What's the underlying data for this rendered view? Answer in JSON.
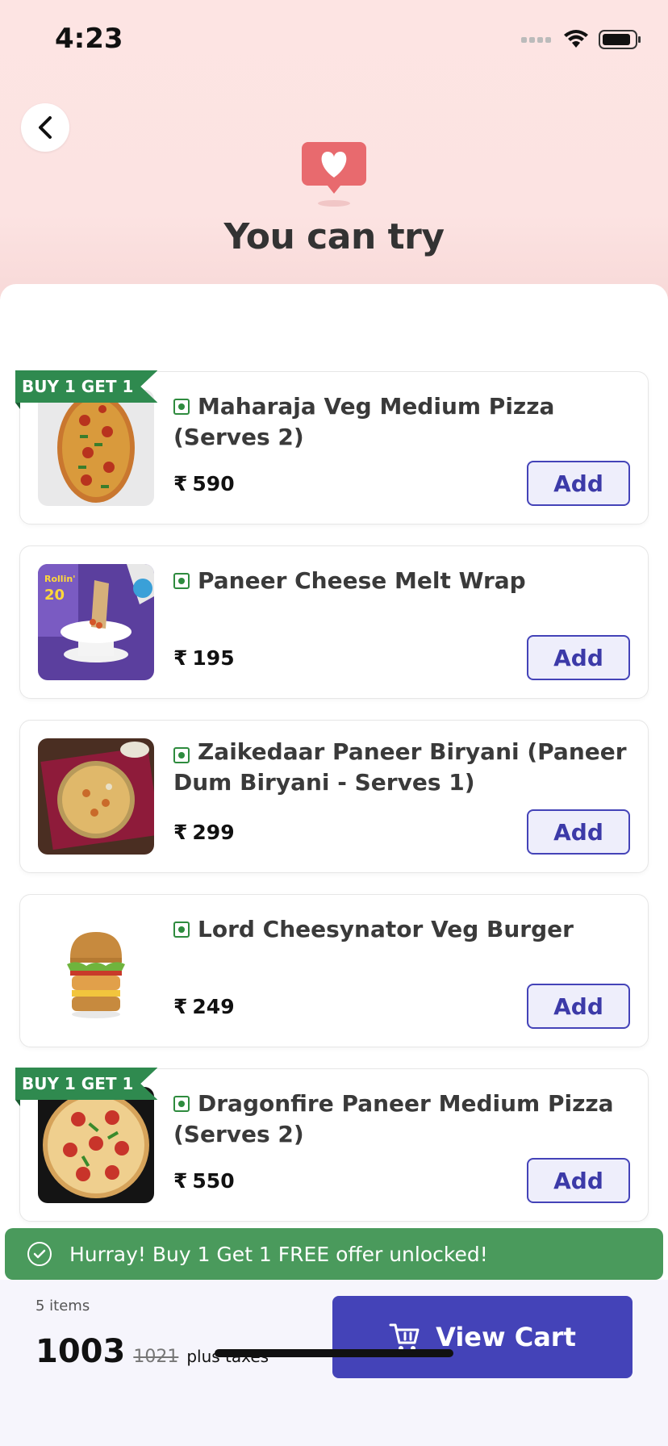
{
  "status_bar": {
    "time": "4:23"
  },
  "header": {
    "title": "You can try"
  },
  "items": [
    {
      "name": "Maharaja Veg Medium Pizza (Serves 2)",
      "price": "590",
      "add_label": "Add",
      "ribbon": "BUY 1 GET 1",
      "veg": true
    },
    {
      "name": "Paneer Cheese Melt Wrap",
      "price": "195",
      "add_label": "Add",
      "ribbon": "",
      "veg": true
    },
    {
      "name": "Zaikedaar Paneer Biryani (Paneer Dum Biryani - Serves 1)",
      "price": "299",
      "add_label": "Add",
      "ribbon": "",
      "veg": true
    },
    {
      "name": "Lord Cheesynator Veg Burger",
      "price": "249",
      "add_label": "Add",
      "ribbon": "",
      "veg": true
    },
    {
      "name": "Dragonfire Paneer Medium Pizza (Serves 2)",
      "price": "550",
      "add_label": "Add",
      "ribbon": "BUY 1 GET 1",
      "veg": true
    }
  ],
  "currency_symbol": "₹",
  "toast": {
    "message": "Hurray! Buy 1 Get 1 FREE offer unlocked!"
  },
  "footer": {
    "items_count": "5 items",
    "total": "1003",
    "original_total": "1021",
    "tax_note": "plus taxes",
    "view_cart_label": "View Cart"
  },
  "colors": {
    "brand": "#4443b8",
    "offer_green": "#2f8a4f",
    "toast_green": "#4a9a5c",
    "header_bg": "#fde4e3",
    "heart": "#e86a6e"
  }
}
